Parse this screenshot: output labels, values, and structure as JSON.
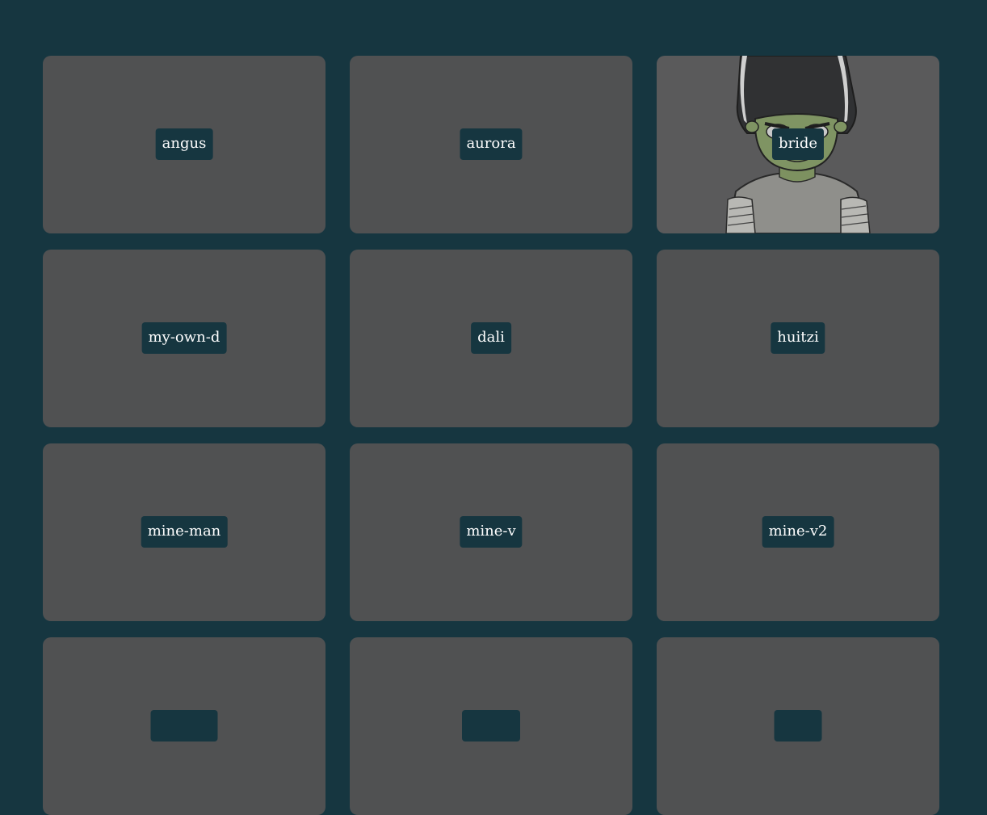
{
  "colors": {
    "page_background": "#163640",
    "card_background": "#505152",
    "label_background": "#163640",
    "label_text": "#ffffff"
  },
  "cards": [
    {
      "label": "angus"
    },
    {
      "label": "aurora"
    },
    {
      "label": "bride",
      "image": "frankenstein-bride-illustration"
    },
    {
      "label": "my-own-d"
    },
    {
      "label": "dali"
    },
    {
      "label": "huitzi"
    },
    {
      "label": "mine-man"
    },
    {
      "label": "mine-v"
    },
    {
      "label": "mine-v2"
    },
    {
      "label": ""
    },
    {
      "label": ""
    },
    {
      "label": ""
    }
  ]
}
